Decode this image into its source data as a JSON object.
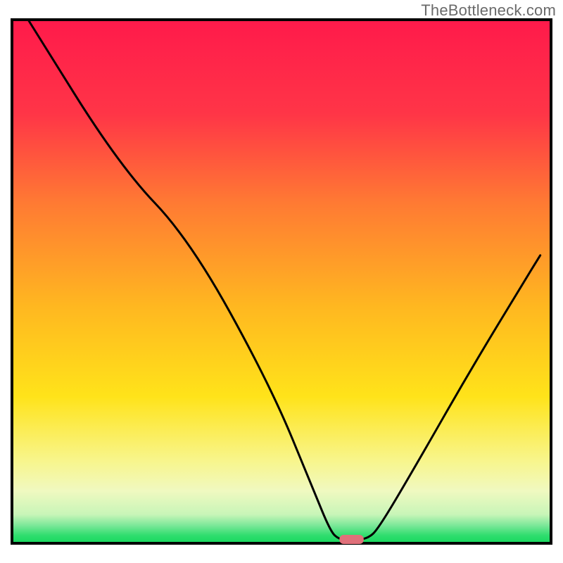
{
  "watermark": "TheBottleneck.com",
  "chart_data": {
    "type": "line",
    "title": "",
    "xlabel": "",
    "ylabel": "",
    "xlim": [
      0,
      100
    ],
    "ylim": [
      0,
      100
    ],
    "gradient_stops": [
      {
        "offset": 0.0,
        "color": "#ff1a4b"
      },
      {
        "offset": 0.18,
        "color": "#ff3547"
      },
      {
        "offset": 0.35,
        "color": "#ff7a33"
      },
      {
        "offset": 0.55,
        "color": "#ffbny820"
      },
      {
        "offset": 0.55,
        "color": "#ffb820"
      },
      {
        "offset": 0.72,
        "color": "#ffe31a"
      },
      {
        "offset": 0.84,
        "color": "#f8f58a"
      },
      {
        "offset": 0.9,
        "color": "#f0f9c0"
      },
      {
        "offset": 0.945,
        "color": "#c8f5b8"
      },
      {
        "offset": 0.965,
        "color": "#7fe89a"
      },
      {
        "offset": 0.985,
        "color": "#2fdd6e"
      },
      {
        "offset": 1.0,
        "color": "#17d85e"
      }
    ],
    "series": [
      {
        "name": "bottleneck-curve",
        "points": [
          {
            "x": 3.0,
            "y": 100.0
          },
          {
            "x": 20.0,
            "y": 72.0
          },
          {
            "x": 33.0,
            "y": 58.0
          },
          {
            "x": 48.0,
            "y": 30.0
          },
          {
            "x": 56.0,
            "y": 10.0
          },
          {
            "x": 59.0,
            "y": 2.5
          },
          {
            "x": 60.5,
            "y": 0.8
          },
          {
            "x": 63.0,
            "y": 0.5
          },
          {
            "x": 66.0,
            "y": 0.9
          },
          {
            "x": 68.0,
            "y": 2.8
          },
          {
            "x": 75.0,
            "y": 15.0
          },
          {
            "x": 85.0,
            "y": 33.0
          },
          {
            "x": 95.0,
            "y": 50.0
          },
          {
            "x": 98.0,
            "y": 55.0
          }
        ]
      }
    ],
    "marker": {
      "name": "optimal-zone",
      "x": 63.0,
      "y": 0.0,
      "width_pct": 4.5,
      "color": "#e0707a"
    }
  }
}
